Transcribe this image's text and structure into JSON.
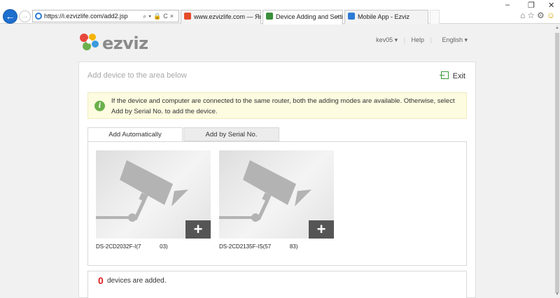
{
  "browser": {
    "url": "https://i.ezvizlife.com/add2.jsp",
    "tabs": [
      {
        "title": "www.ezvizlife.com — Яндекс.",
        "favicon_color": "#e54b2b",
        "active": false
      },
      {
        "title": "Device Adding and Settings",
        "favicon_color": "#3a8f3a",
        "active": true
      },
      {
        "title": "Mobile App - Ezviz",
        "favicon_color": "#2b7bd6",
        "active": false
      }
    ],
    "window_controls": {
      "minimize": "–",
      "restore": "❐",
      "close": "✕"
    },
    "toolbar_icons": [
      "home-icon",
      "star-icon",
      "gear-icon",
      "smiley-icon"
    ]
  },
  "header": {
    "logo_text": "ezviz",
    "user": "kev05",
    "help": "Help",
    "language": "English"
  },
  "panel": {
    "title": "Add device to the area below",
    "exit_label": "Exit",
    "notice": "If the device and computer are connected to the same router, both the adding modes are available. Otherwise, select Add by Serial No. to add the device.",
    "tabs": [
      "Add Automatically",
      "Add by Serial No."
    ],
    "devices": [
      {
        "name": "DS-2CD2032F-I(7            03)"
      },
      {
        "name": "DS-2CD2135F-IS(57            83)"
      }
    ],
    "added_count": "0",
    "added_label": "devices are added."
  },
  "colors": {
    "accent_green": "#6ab04c",
    "count_red": "#e02020",
    "notice_bg": "#fdfbe0"
  }
}
